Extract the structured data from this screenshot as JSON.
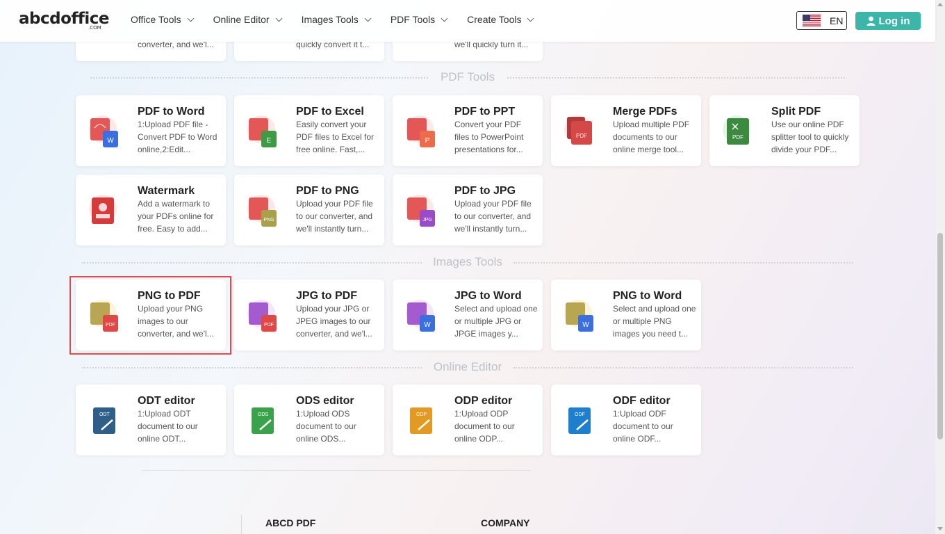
{
  "header": {
    "logo": "abcdoffice",
    "logo_sub": ".COM",
    "nav": [
      "Office Tools",
      "Online Editor",
      "Images Tools",
      "PDF Tools",
      "Create Tools"
    ],
    "language": "EN",
    "login": "Log in"
  },
  "top_cards": [
    {
      "desc": "converter, and we'l..."
    },
    {
      "desc": "quickly convert it t..."
    },
    {
      "desc": "we'll quickly turn it..."
    }
  ],
  "sections": {
    "pdf_tools": "PDF Tools",
    "images_tools": "Images Tools",
    "online_editor": "Online Editor"
  },
  "pdf_tools": [
    {
      "title": "PDF to Word",
      "desc": "1:Upload PDF file - Convert PDF to Word online,2:Edit...",
      "icon": "pdf-to-word-icon",
      "badge": "W"
    },
    {
      "title": "PDF to Excel",
      "desc": "Easily convert your PDF files to Excel for free online. Fast,...",
      "icon": "pdf-to-excel-icon",
      "badge": "E"
    },
    {
      "title": "PDF to PPT",
      "desc": "Convert your PDF files to PowerPoint presentations for...",
      "icon": "pdf-to-ppt-icon",
      "badge": "P"
    },
    {
      "title": "Merge PDFs",
      "desc": "Upload multiple PDF documents to our online merge tool...",
      "icon": "merge-pdf-icon",
      "badge": "PDF"
    },
    {
      "title": "Split PDF",
      "desc": "Use our online PDF splitter tool to quickly divide your PDF...",
      "icon": "split-pdf-icon",
      "badge": "PDF"
    },
    {
      "title": "Watermark",
      "desc": "Add a watermark to your PDFs online for free. Easy to add...",
      "icon": "watermark-icon",
      "badge": ""
    },
    {
      "title": "PDF to PNG",
      "desc": "Upload your PDF file to our converter, and we'll instantly turn...",
      "icon": "pdf-to-png-icon",
      "badge": "PNG"
    },
    {
      "title": "PDF to JPG",
      "desc": "Upload your PDF file to our converter, and we'll instantly turn...",
      "icon": "pdf-to-jpg-icon",
      "badge": "JPG"
    }
  ],
  "images_tools": [
    {
      "title": "PNG to PDF",
      "desc": "Upload your PNG images to our converter, and we'l...",
      "icon": "png-to-pdf-icon",
      "badge": "PDF"
    },
    {
      "title": "JPG to PDF",
      "desc": "Upload your JPG or JPEG images to our converter, and we'l...",
      "icon": "jpg-to-pdf-icon",
      "badge": "PDF"
    },
    {
      "title": "JPG to Word",
      "desc": "Select and upload one or multiple JPG or JPGE images y...",
      "icon": "jpg-to-word-icon",
      "badge": "W"
    },
    {
      "title": "PNG to Word",
      "desc": "Select and upload one or multiple PNG images you need t...",
      "icon": "png-to-word-icon",
      "badge": "W"
    }
  ],
  "online_editor": [
    {
      "title": "ODT editor",
      "desc": "1:Upload ODT document to our online ODT...",
      "icon": "odt-editor-icon",
      "badge": "ODT"
    },
    {
      "title": "ODS editor",
      "desc": "1:Upload ODS document to our online ODS...",
      "icon": "ods-editor-icon",
      "badge": "ODS"
    },
    {
      "title": "ODP editor",
      "desc": "1:Upload ODP document to our online ODP...",
      "icon": "odp-editor-icon",
      "badge": "ODP"
    },
    {
      "title": "ODF editor",
      "desc": "1:Upload ODF document to our online ODF...",
      "icon": "odf-editor-icon",
      "badge": "ODF"
    }
  ],
  "footer": {
    "col1": "ABCD PDF",
    "col2": "COMPANY"
  },
  "colors": {
    "accent": "#3bb6a8",
    "highlight": "#e34b4b",
    "section_label": "#bfc3c8"
  }
}
